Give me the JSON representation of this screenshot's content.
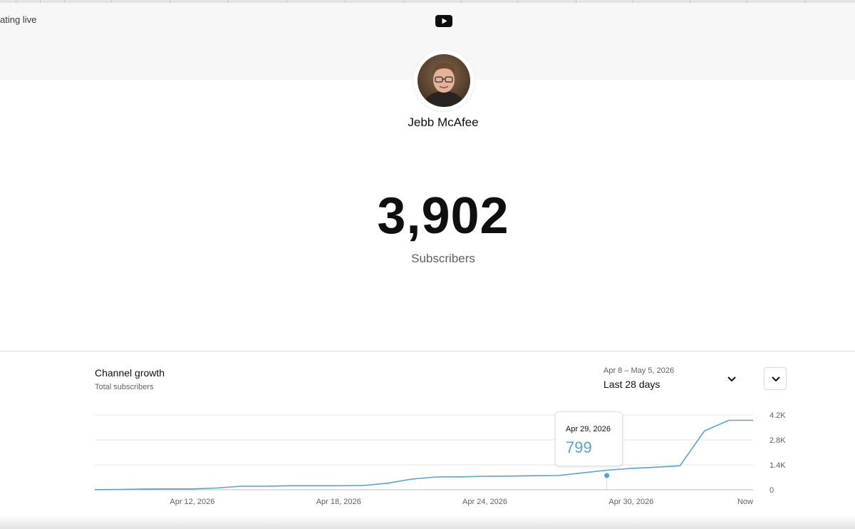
{
  "header": {
    "live_text": "ating live",
    "logo_icon": "youtube-logo-icon"
  },
  "channel": {
    "name": "Jebb McAfee",
    "subscriber_count": "3,902",
    "subscriber_label": "Subscribers"
  },
  "growth": {
    "title": "Channel growth",
    "subtitle": "Total subscribers",
    "range_dates": "Apr 8 – May 5, 2026",
    "range_label": "Last 28 days",
    "range_icon": "chevron-down-icon",
    "options_icon": "chevron-down-icon"
  },
  "tooltip": {
    "date": "Apr 29, 2026",
    "value": "799"
  },
  "colors": {
    "line": "#5aa2c7",
    "grid": "#e5e5e5"
  },
  "chart_data": {
    "type": "line",
    "title": "Channel growth",
    "subtitle": "Total subscribers",
    "x_tick_labels": [
      "Apr 12, 2026",
      "Apr 18, 2026",
      "Apr 24, 2026",
      "Apr 30, 2026",
      "Now"
    ],
    "y_tick_labels": [
      "0",
      "1.4K",
      "2.8K",
      "4.2K"
    ],
    "y_ticks": [
      0,
      1400,
      2800,
      4200
    ],
    "ylim": [
      0,
      4200
    ],
    "grid": true,
    "series": [
      {
        "x": [
          "Apr 8, 2026",
          "Apr 9, 2026",
          "Apr 10, 2026",
          "Apr 11, 2026",
          "Apr 12, 2026",
          "Apr 13, 2026",
          "Apr 14, 2026",
          "Apr 15, 2026",
          "Apr 16, 2026",
          "Apr 17, 2026",
          "Apr 18, 2026",
          "Apr 19, 2026",
          "Apr 20, 2026",
          "Apr 21, 2026",
          "Apr 22, 2026",
          "Apr 23, 2026",
          "Apr 24, 2026",
          "Apr 25, 2026",
          "Apr 26, 2026",
          "Apr 27, 2026",
          "Apr 28, 2026",
          "Apr 29, 2026",
          "Apr 30, 2026",
          "May 1, 2026",
          "May 2, 2026",
          "May 3, 2026",
          "May 4, 2026",
          "May 5, 2026"
        ],
        "values": [
          10,
          20,
          45,
          50,
          50,
          100,
          200,
          200,
          230,
          230,
          230,
          240,
          370,
          600,
          720,
          730,
          760,
          770,
          790,
          799,
          950,
          1100,
          1200,
          1270,
          1350,
          3300,
          3902,
          3902
        ]
      }
    ],
    "highlight": {
      "x": "Apr 29, 2026",
      "value": 799
    }
  }
}
